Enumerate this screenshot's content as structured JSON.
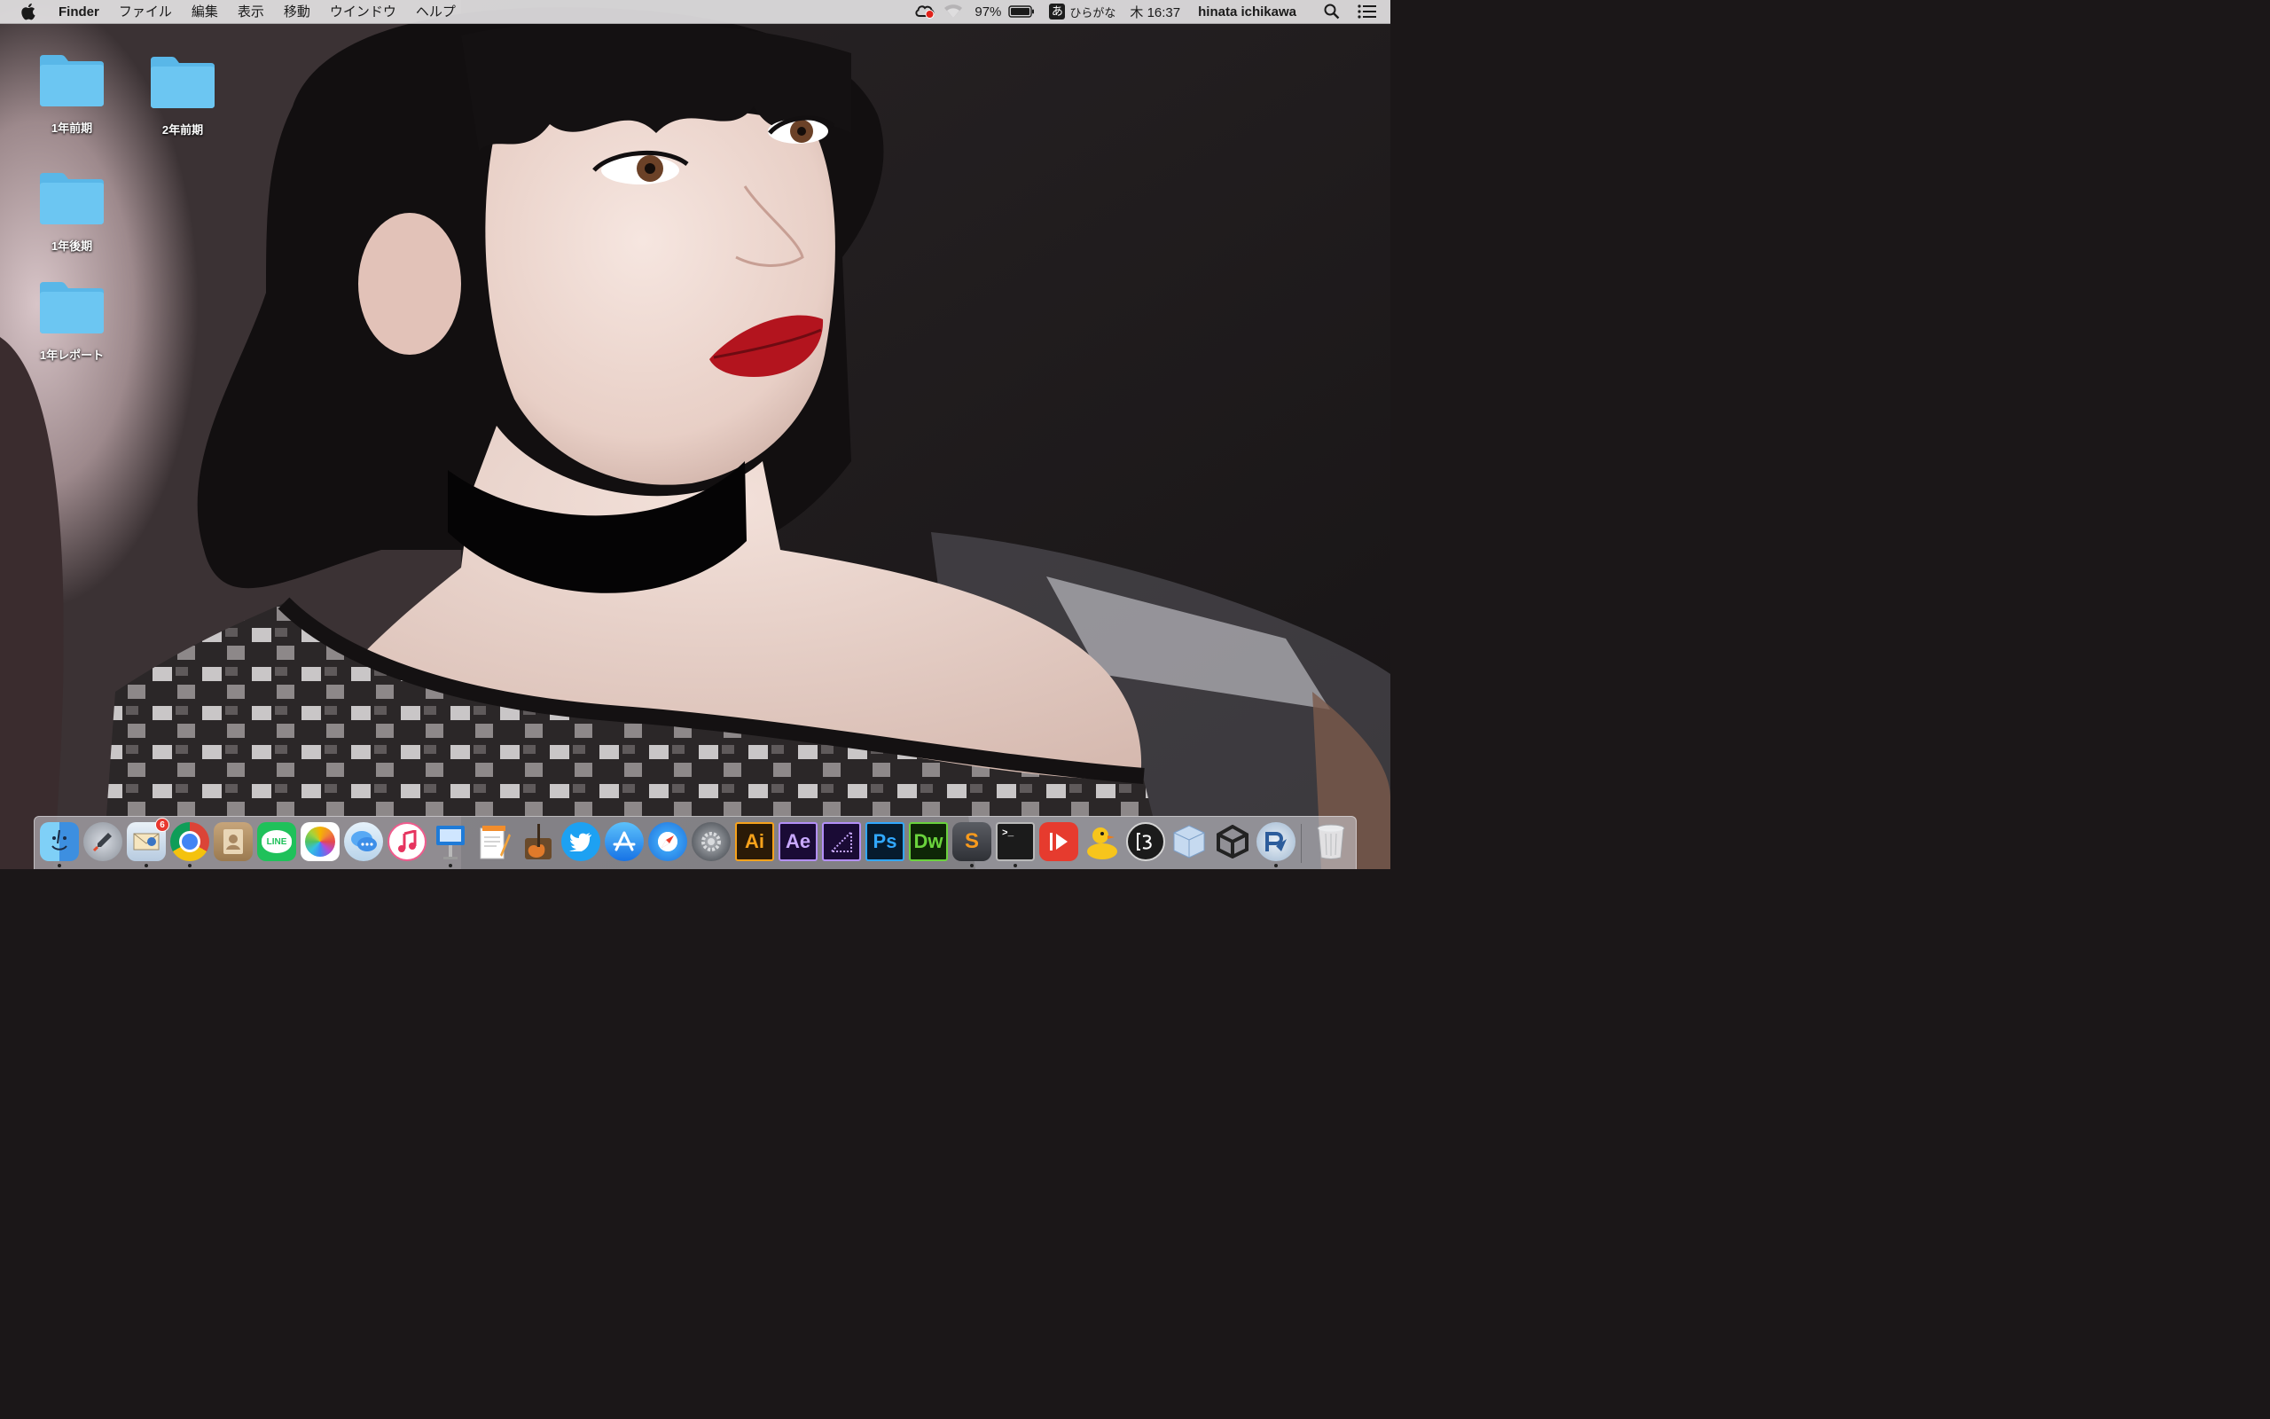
{
  "menubar": {
    "app_name": "Finder",
    "menus": [
      "ファイル",
      "編集",
      "表示",
      "移動",
      "ウインドウ",
      "ヘルプ"
    ],
    "battery_percent": "97%",
    "input_method_icon_char": "あ",
    "input_method": "ひらがな",
    "clock": "木 16:37",
    "user": "hinata ichikawa",
    "status_icons": [
      "creative-cloud-icon",
      "wifi-icon",
      "battery-icon",
      "spotlight-icon",
      "notification-center-icon"
    ]
  },
  "desktop": {
    "folders": [
      {
        "label": "1年前期"
      },
      {
        "label": "2年前期"
      },
      {
        "label": "1年後期"
      },
      {
        "label": "1年レポート"
      }
    ]
  },
  "dock": {
    "items": [
      {
        "name": "finder",
        "running": true
      },
      {
        "name": "launchpad",
        "running": false
      },
      {
        "name": "mail",
        "running": true,
        "badge": "6"
      },
      {
        "name": "chrome",
        "running": true
      },
      {
        "name": "contacts",
        "running": false
      },
      {
        "name": "line",
        "running": false,
        "label": "LINE"
      },
      {
        "name": "photos",
        "running": false
      },
      {
        "name": "messages",
        "running": false
      },
      {
        "name": "itunes",
        "running": false
      },
      {
        "name": "keynote",
        "running": true
      },
      {
        "name": "pages",
        "running": false
      },
      {
        "name": "garageband",
        "running": false
      },
      {
        "name": "twitter",
        "running": false
      },
      {
        "name": "app-store",
        "running": false
      },
      {
        "name": "safari",
        "running": false
      },
      {
        "name": "system-preferences",
        "running": false
      },
      {
        "name": "illustrator",
        "running": false,
        "label": "Ai"
      },
      {
        "name": "after-effects",
        "running": false,
        "label": "Ae"
      },
      {
        "name": "media-encoder",
        "running": false
      },
      {
        "name": "photoshop",
        "running": false,
        "label": "Ps"
      },
      {
        "name": "dreamweaver",
        "running": false,
        "label": "Dw"
      },
      {
        "name": "sublime-text",
        "running": true,
        "label": "S"
      },
      {
        "name": "terminal",
        "running": true,
        "label": ">_"
      },
      {
        "name": "video-player",
        "running": false
      },
      {
        "name": "cyberduck",
        "running": false
      },
      {
        "name": "bracket-editor",
        "running": false
      },
      {
        "name": "virtualbox",
        "running": false
      },
      {
        "name": "unity",
        "running": false
      },
      {
        "name": "paw",
        "running": true
      },
      {
        "name": "trash",
        "running": false
      }
    ]
  },
  "colors": {
    "folder_blue": "#6cc6f2",
    "folder_tab": "#59b7e8",
    "menubar_bg": "#eceaec",
    "badge_red": "#e8372f"
  }
}
